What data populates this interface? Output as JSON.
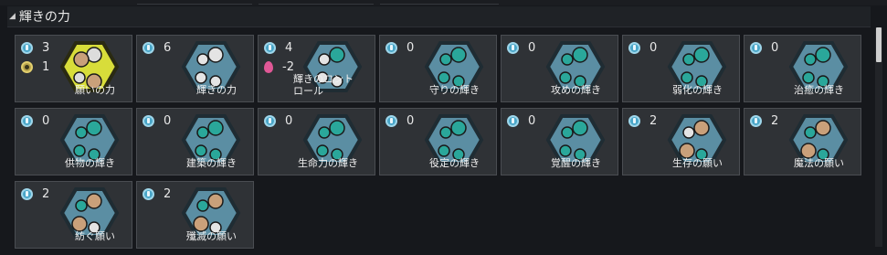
{
  "section": {
    "title": "輝きの力",
    "arrow": "◢"
  },
  "cards": [
    {
      "count": "3",
      "sub_count": "1",
      "sub_icon": "gold",
      "label": "願いの力",
      "hex": "yellow",
      "orbs": [
        "pearl",
        "tan",
        "pearl",
        "tan"
      ]
    },
    {
      "count": "6",
      "sub_count": "",
      "sub_icon": "",
      "label": "輝きの力",
      "hex": "blue",
      "orbs": [
        "white",
        "white",
        "white",
        "white"
      ]
    },
    {
      "count": "4",
      "sub_count": "-2",
      "sub_icon": "fire",
      "label": "輝きのコントロール",
      "hex": "blue",
      "orbs": [
        "teal",
        "white",
        "white",
        "white"
      ]
    },
    {
      "count": "0",
      "sub_count": "",
      "sub_icon": "",
      "label": "守りの輝き",
      "hex": "blue",
      "orbs": [
        "teal",
        "teal",
        "teal",
        "teal"
      ]
    },
    {
      "count": "0",
      "sub_count": "",
      "sub_icon": "",
      "label": "攻めの輝き",
      "hex": "blue",
      "orbs": [
        "teal",
        "teal",
        "teal",
        "teal"
      ]
    },
    {
      "count": "0",
      "sub_count": "",
      "sub_icon": "",
      "label": "弱化の輝き",
      "hex": "blue",
      "orbs": [
        "teal",
        "teal",
        "teal",
        "teal"
      ]
    },
    {
      "count": "0",
      "sub_count": "",
      "sub_icon": "",
      "label": "治癒の輝き",
      "hex": "blue",
      "orbs": [
        "teal",
        "teal",
        "teal",
        "teal"
      ]
    },
    {
      "count": "0",
      "sub_count": "",
      "sub_icon": "",
      "label": "供物の輝き",
      "hex": "blue",
      "orbs": [
        "teal",
        "teal",
        "teal",
        "teal"
      ]
    },
    {
      "count": "0",
      "sub_count": "",
      "sub_icon": "",
      "label": "建築の輝き",
      "hex": "blue",
      "orbs": [
        "teal",
        "teal",
        "teal",
        "teal"
      ]
    },
    {
      "count": "0",
      "sub_count": "",
      "sub_icon": "",
      "label": "生命力の輝き",
      "hex": "blue",
      "orbs": [
        "teal",
        "teal",
        "teal",
        "teal"
      ]
    },
    {
      "count": "0",
      "sub_count": "",
      "sub_icon": "",
      "label": "役定の輝き",
      "hex": "blue",
      "orbs": [
        "teal",
        "teal",
        "teal",
        "teal"
      ]
    },
    {
      "count": "0",
      "sub_count": "",
      "sub_icon": "",
      "label": "覚醒の輝き",
      "hex": "blue",
      "orbs": [
        "teal",
        "teal",
        "teal",
        "teal"
      ]
    },
    {
      "count": "2",
      "sub_count": "",
      "sub_icon": "",
      "label": "生存の願い",
      "hex": "blue",
      "orbs": [
        "tan",
        "white",
        "tan",
        "teal"
      ]
    },
    {
      "count": "2",
      "sub_count": "",
      "sub_icon": "",
      "label": "魔法の願い",
      "hex": "blue",
      "orbs": [
        "tan",
        "teal",
        "tan",
        "teal"
      ]
    },
    {
      "count": "2",
      "sub_count": "",
      "sub_icon": "",
      "label": "紡ぐ願い",
      "hex": "blue",
      "orbs": [
        "tan",
        "teal",
        "tan",
        "white"
      ]
    },
    {
      "count": "2",
      "sub_count": "",
      "sub_icon": "",
      "label": "殲滅の願い",
      "hex": "blue",
      "orbs": [
        "tan",
        "teal",
        "tan",
        "white"
      ]
    }
  ],
  "colors": {
    "hex_blue_fill": "#5b8ea3",
    "hex_blue_stroke": "#1f2c33",
    "hex_yellow_fill": "#d8dd3a",
    "hex_yellow_stroke": "#2a2a12",
    "orb_teal": "#2aa79a",
    "orb_white": "#e4e4e4",
    "orb_tan": "#c9a07a",
    "orb_pearl": "#dcdcdc"
  }
}
